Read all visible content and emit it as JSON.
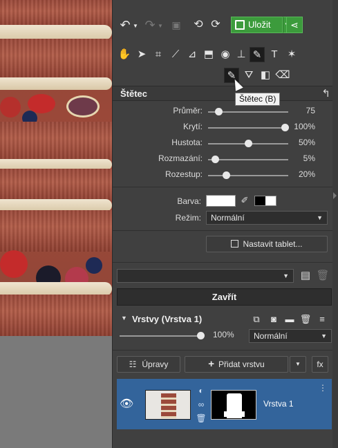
{
  "toolbar": {
    "save_label": "Uložit"
  },
  "tooltip": "Štětec (B)",
  "brush_panel": {
    "title": "Štětec",
    "sliders": [
      {
        "label": "Průměr:",
        "value": "75",
        "level": 0.13
      },
      {
        "label": "Krytí:",
        "value": "100%",
        "level": 0.96
      },
      {
        "label": "Hustota:",
        "value": "50%",
        "level": 0.5
      },
      {
        "label": "Rozmazání:",
        "value": "5%",
        "level": 0.09
      },
      {
        "label": "Rozestup:",
        "value": "20%",
        "level": 0.22
      }
    ],
    "color_label": "Barva:",
    "mode_label": "Režim:",
    "mode_value": "Normální",
    "tablet_button": "Nastavit tablet...",
    "close_button": "Zavřít"
  },
  "layers": {
    "title": "Vrstvy (Vrstva 1)",
    "opacity": "100%",
    "blend_mode": "Normální",
    "adjust_button": "Úpravy",
    "add_layer_button": "Přidat vrstvu",
    "fx_label": "fx",
    "layer_name": "Vrstva 1"
  },
  "colors": {
    "save_green": "#3c9b3c",
    "layer_selected": "#33649b",
    "panel_bg": "#404040"
  }
}
